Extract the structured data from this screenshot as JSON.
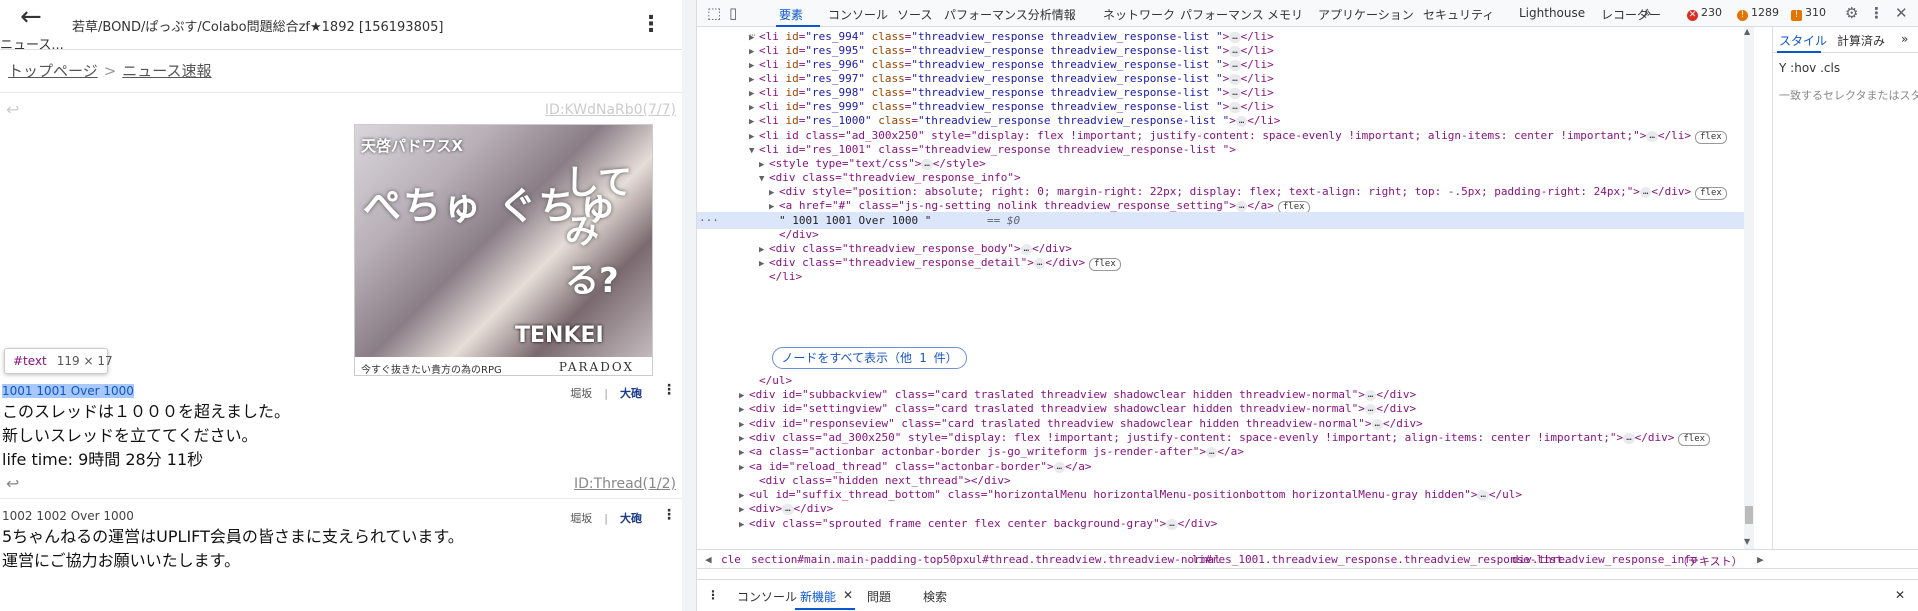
{
  "thread": {
    "back_label": "ニュース...",
    "title": "若草/BOND/ぱっぷす/Colabo問題総合zf★1892 [156193805]",
    "breadcrumb": [
      "トップページ",
      "ニュース速報"
    ],
    "top_id": "ID:KWdNaRb0(7/7)"
  },
  "ad": {
    "title": "天啓パドワスX",
    "text_main": "ぺちゅ ぐちゅ",
    "text_side": "してみる?",
    "logo": "TENKEI",
    "caption": "今すぐ抜きたい貴方の為のRPG",
    "brand": "PARADOX"
  },
  "tooltip": {
    "kind": "#text",
    "dims": "119 × 17"
  },
  "responses": [
    {
      "info": "1001 1001 Over 1000",
      "act_a": "堀坂",
      "act_b": "大砲",
      "lines": [
        "このスレッドは１０００を超えました。",
        "新しいスレッドを立ててください。",
        "life time: 9時間 28分 11秒"
      ],
      "id": "ID:Thread(1/2)"
    },
    {
      "info": "1002 1002 Over 1000",
      "act_a": "堀坂",
      "act_b": "大砲",
      "lines": [
        "5ちゃんねるの運営はUPLIFT会員の皆さまに支えられています。",
        "運営にご協力お願いいたします。"
      ]
    }
  ],
  "devtools": {
    "tabs": [
      "要素",
      "コンソール",
      "ソース",
      "パフォーマンス分析情報",
      "ネットワーク",
      "パフォーマンス",
      "メモリ",
      "アプリケーション",
      "セキュリティ",
      "Lighthouse",
      "レコーダー"
    ],
    "more": "»",
    "errors": "230",
    "warnings": "1289",
    "issues": "310",
    "show_all": "ノードをすべて表示（他 1 件）",
    "lines": [
      [
        "li",
        "res_994",
        "threadview_response threadview_response-list "
      ],
      [
        "li",
        "res_995",
        "threadview_response threadview_response-list "
      ],
      [
        "li",
        "res_996",
        "threadview_response threadview_response-list "
      ],
      [
        "li",
        "res_997",
        "threadview_response threadview_response-list "
      ],
      [
        "li",
        "res_998",
        "threadview_response threadview_response-list "
      ],
      [
        "li",
        "res_999",
        "threadview_response threadview_response-list "
      ],
      [
        "li",
        "res_1000",
        "threadview_response threadview_response-list "
      ]
    ],
    "ad_line": "<li id class=\"ad_300x250\" style=\"display: flex !important; justify-content: space-evenly !important; align-items: center !important;\">",
    "res1001": "<li id=\"res_1001\" class=\"threadview_response threadview_response-list \">",
    "style_line": "<style type=\"text/css\">",
    "style_close": "</style>",
    "info_div": "<div class=\"threadview_response_info\">",
    "abs_div": "<div style=\"position: absolute; right: 0; margin-right: 22px; display: flex; text-align: right; top: -.5px; padding-right: 24px;\">",
    "a_line": "<a href=\"#\" class=\"js-ng-setting nolink threadview_response_setting\">",
    "text_node": "\" 1001 1001 Over 1000 \"",
    "eq": "== $0",
    "div_close": "</div>",
    "body_div": "<div class=\"threadview_response_body\">",
    "detail_div": "<div class=\"threadview_response_detail\">",
    "li_close": "</li>",
    "ul_close": "</ul>",
    "after": [
      "<div id=\"subbackview\" class=\"card traslated threadview shadowclear hidden threadview-normal\">",
      "<div id=\"settingview\" class=\"card traslated threadview shadowclear hidden threadview-normal\">",
      "<div id=\"responseview\" class=\"card traslated threadview shadowclear hidden threadview-normal\">",
      "<div class=\"ad_300x250\" style=\"display: flex !important; justify-content: space-evenly !important; align-items: center !important;\">",
      "<a class=\"actionbar actonbar-border js-go_writeform js-render-after\">",
      "<a id=\"reload_thread\" class=\"actonbar-border\">",
      "<div class=\"hidden next_thread\"></div>",
      "<ul id=\"suffix_thread_bottom\" class=\"horizontalMenu horizontalMenu-positionbottom horizontalMenu-gray hidden\">",
      "<div>",
      "<div class=\"sprouted frame center flex center background-gray\">"
    ],
    "flex_label": "flex",
    "ellipsis": "…",
    "side_tabs": [
      "スタイル",
      "計算済み"
    ],
    "filter_label": ":hov .cls",
    "filter_icon": "Y",
    "rule_hint": "一致するセレクタまたはスタ",
    "crumbs": [
      "cle",
      "section#main.main-padding-top50px",
      "ul#thread.threadview.threadview-normal",
      "li#res_1001.threadview_response.threadview_response-list.",
      "div.threadview_response_info",
      "（テキスト）"
    ],
    "drawer_tabs": [
      "コンソール",
      "新機能",
      "問題",
      "検索"
    ]
  }
}
